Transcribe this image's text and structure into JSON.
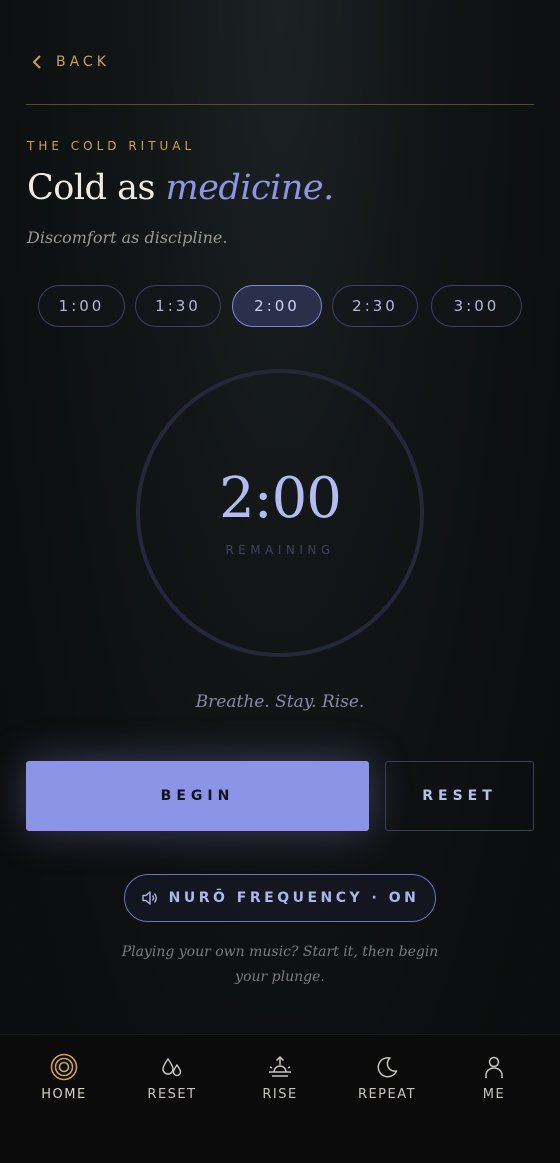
{
  "header": {
    "back_label": "BACK",
    "eyebrow": "THE COLD RITUAL",
    "title_plain": "Cold as ",
    "title_emphasis": "medicine.",
    "subtitle": "Discomfort as discipline."
  },
  "durations": {
    "options": [
      "1:00",
      "1:30",
      "2:00",
      "2:30",
      "3:00"
    ],
    "selected": "2:00"
  },
  "timer": {
    "time": "2:00",
    "label": "REMAINING"
  },
  "mantra": "Breathe. Stay. Rise.",
  "actions": {
    "begin_label": "BEGIN",
    "reset_label": "RESET"
  },
  "frequency": {
    "label": "NURŌ FREQUENCY · ON",
    "note": "Playing your own music? Start it, then begin your plunge."
  },
  "tabbar": {
    "items": [
      {
        "label": "HOME",
        "icon": "concentric-circles-icon",
        "active": true
      },
      {
        "label": "RESET",
        "icon": "droplets-icon",
        "active": false
      },
      {
        "label": "RISE",
        "icon": "sunrise-icon",
        "active": false
      },
      {
        "label": "REPEAT",
        "icon": "moon-icon",
        "active": false
      },
      {
        "label": "ME",
        "icon": "person-icon",
        "active": false
      }
    ]
  },
  "colors": {
    "gold_accent": "#c9a257",
    "periwinkle_accent": "#8c94e8",
    "background": "#0d0f10"
  }
}
